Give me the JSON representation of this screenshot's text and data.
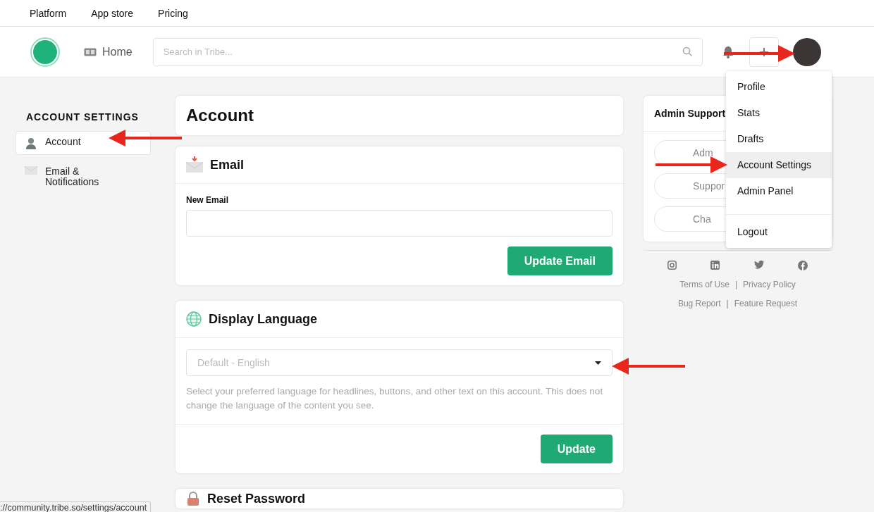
{
  "top_nav": [
    {
      "label": "Platform"
    },
    {
      "label": "App store"
    },
    {
      "label": "Pricing"
    }
  ],
  "header": {
    "home_label": "Home",
    "search": {
      "placeholder": "Search in Tribe..."
    }
  },
  "sidebar": {
    "title": "ACCOUNT SETTINGS",
    "items": [
      {
        "label": "Account",
        "selected": true
      },
      {
        "label": "Email & Notifications",
        "selected": false
      }
    ]
  },
  "page_title": "Account",
  "sections": [
    {
      "kind": "email",
      "title": "Email",
      "field_label": "New Email",
      "button": "Update Email"
    },
    {
      "kind": "language",
      "title": "Display Language",
      "select": {
        "placeholder": "Default - English"
      },
      "help": "Select your preferred language for headlines, buttons, and other text on this account. This does not change the language of the content you see.",
      "button": "Update"
    },
    {
      "kind": "password",
      "title": "Reset Password"
    }
  ],
  "right_panel": {
    "title": "Admin Support",
    "buttons": [
      "Adm",
      "Suppor",
      "Cha"
    ],
    "links": [
      [
        "Terms of Use",
        "|",
        "Privacy Policy"
      ],
      [
        "Bug Report",
        "|",
        "Feature Request"
      ]
    ]
  },
  "user_menu": {
    "groups": [
      [
        {
          "label": "Profile",
          "selected": false
        },
        {
          "label": "Stats",
          "selected": false
        },
        {
          "label": "Drafts",
          "selected": false
        },
        {
          "label": "Account Settings",
          "selected": true
        },
        {
          "label": "Admin Panel",
          "selected": false
        }
      ],
      [
        {
          "label": "Logout",
          "selected": false
        }
      ]
    ]
  },
  "status_bar": {
    "url": "://community.tribe.so/settings/account"
  }
}
